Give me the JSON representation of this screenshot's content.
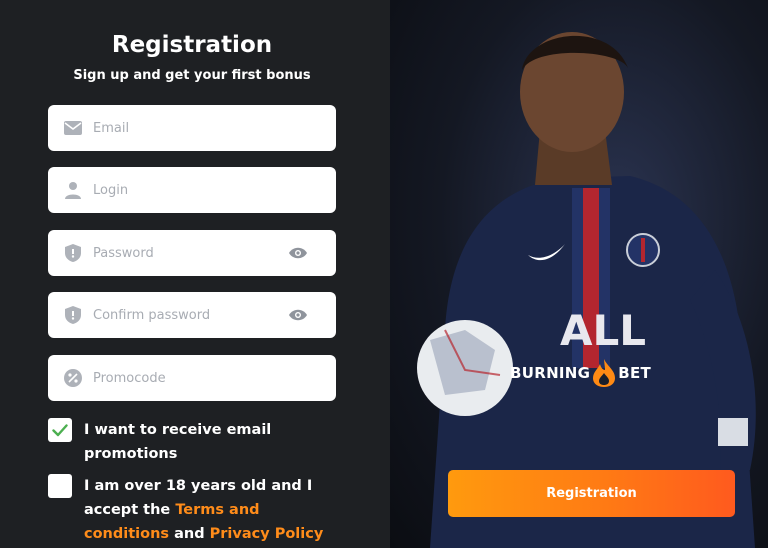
{
  "form": {
    "title": "Registration",
    "subtitle": "Sign up and get your first bonus",
    "fields": {
      "email": {
        "placeholder": "Email",
        "value": "",
        "icon": "envelope-icon"
      },
      "login": {
        "placeholder": "Login",
        "value": "",
        "icon": "user-icon"
      },
      "password": {
        "placeholder": "Password",
        "value": "",
        "icon": "shield-icon",
        "toggle_icon": "eye-icon"
      },
      "confirm_password": {
        "placeholder": "Confirm password",
        "value": "",
        "icon": "shield-icon",
        "toggle_icon": "eye-icon"
      },
      "promocode": {
        "placeholder": "Promocode",
        "value": "",
        "icon": "percent-badge-icon"
      }
    },
    "email_promotions": {
      "checked": true,
      "label": "I want to receive email promotions"
    },
    "age_terms": {
      "checked": false,
      "text_1": "I am over 18 years old and I accept the ",
      "terms_link": "Terms and conditions",
      "text_2": " and ",
      "privacy_link": "Privacy Policy"
    }
  },
  "promo": {
    "brand_left": "BURNING",
    "brand_right": "BET",
    "brand_icon": "flame-icon",
    "register_button": "Registration"
  },
  "colors": {
    "accent": "#ff8c1a",
    "check_green": "#4caf50",
    "panel_bg": "#1e2023"
  }
}
